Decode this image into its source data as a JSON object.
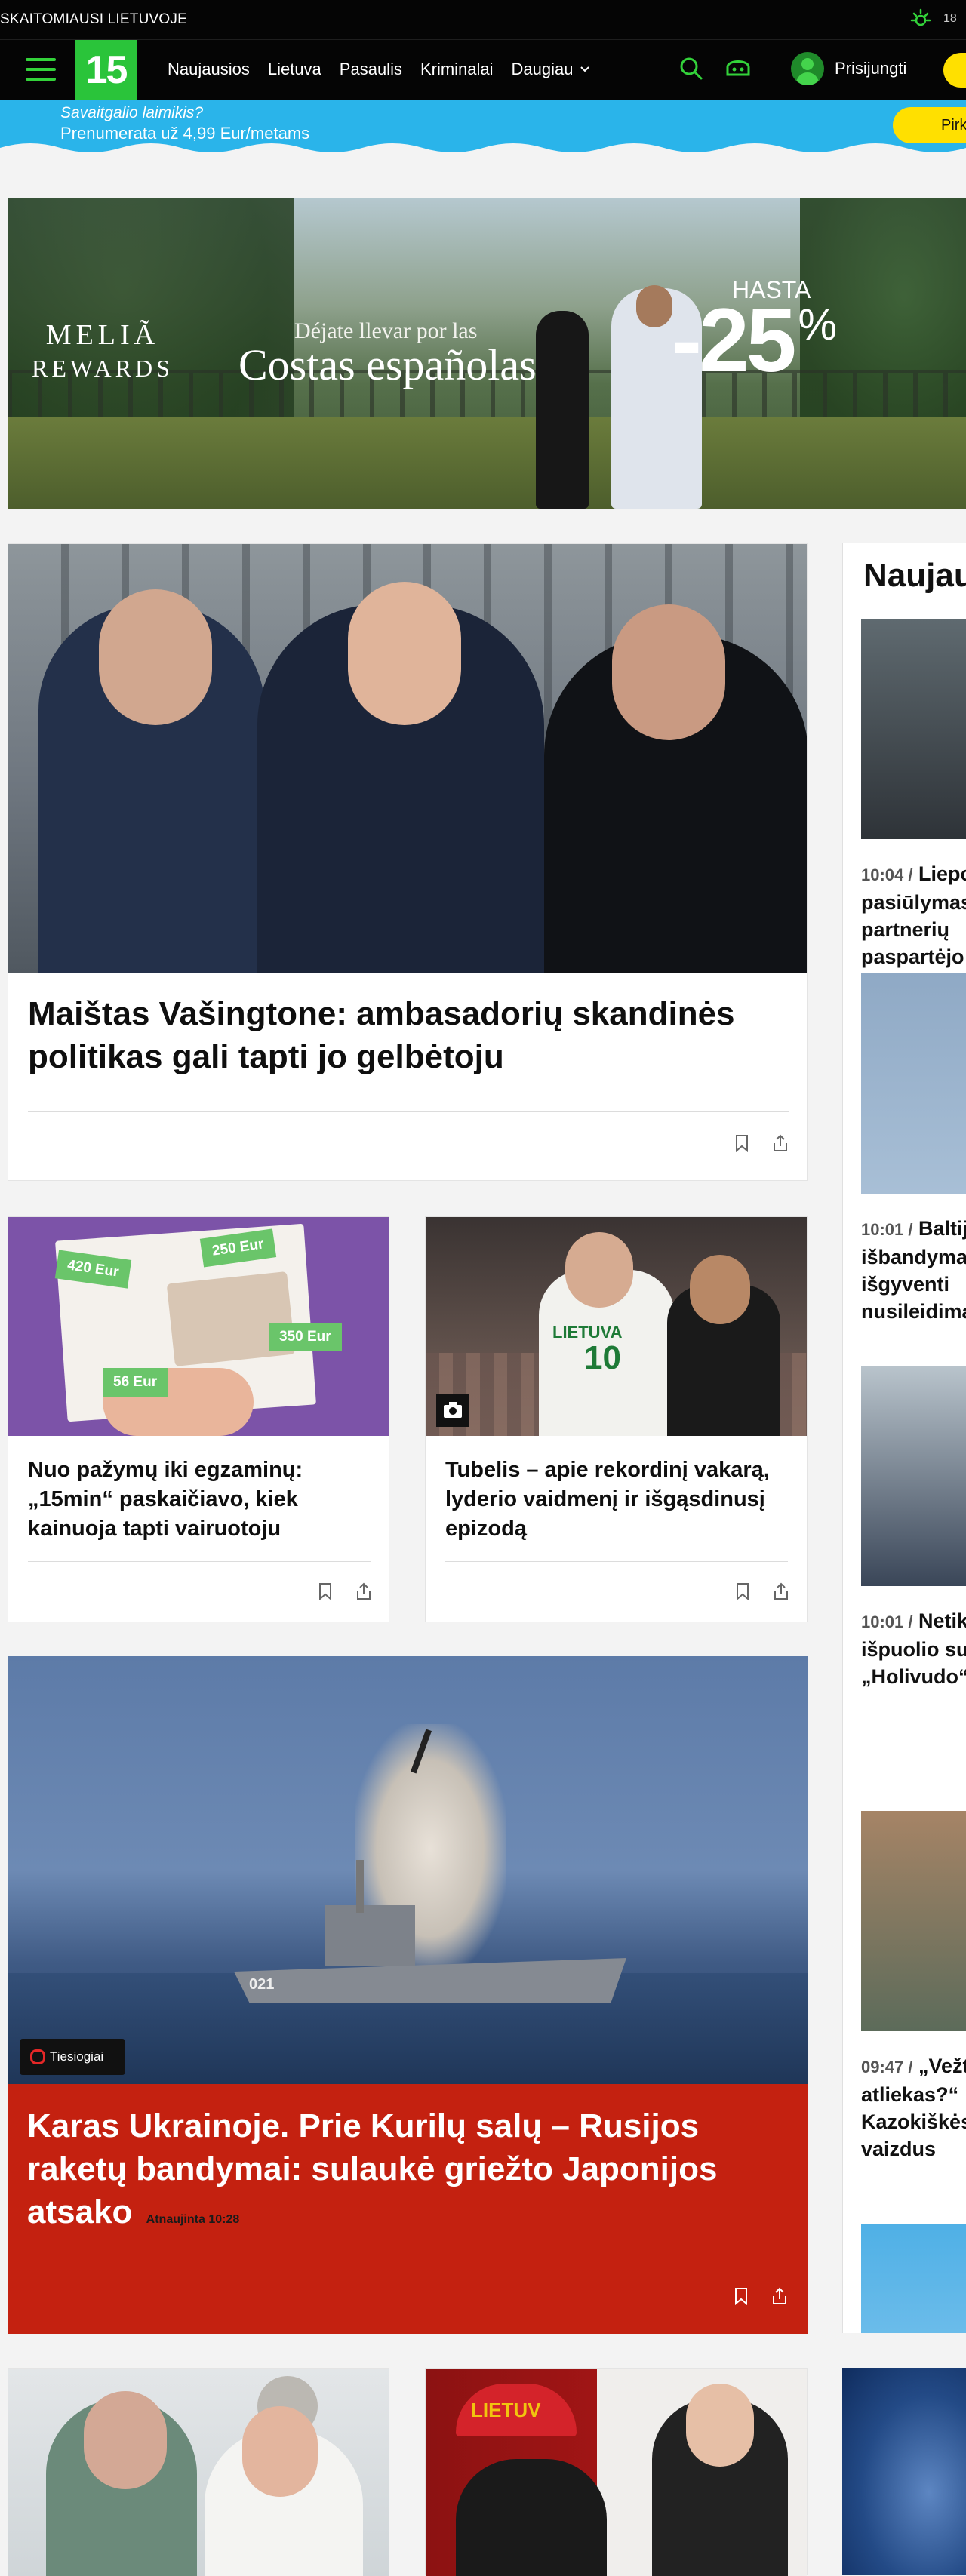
{
  "top": {
    "tagline": "SKAITOMIAUSI LIETUVOJE",
    "weather_temp": "18"
  },
  "nav": {
    "logo": "15",
    "links": [
      "Naujausios",
      "Lietuva",
      "Pasaulis",
      "Kriminalai",
      "Daugiau"
    ],
    "login": "Prisijungti",
    "accent": "#33d23a"
  },
  "promo": {
    "line1": "Savaitgalio laimikis?",
    "line2": "Prenumerata už 4,99 Eur/metams",
    "button": "Pirk"
  },
  "ad": {
    "brand_line1": "MELIÃ",
    "brand_line2": "REWARDS",
    "tagline_small": "Déjate llevar por las",
    "tagline_big": "Costas españolas",
    "hasta": "HASTA",
    "discount": "-25",
    "percent": "%"
  },
  "lead": {
    "title": "Maištas Vašingtone: ambasadorių skandinės politikas gali tapti jo gelbėtoju"
  },
  "card_left": {
    "title": "Nuo pažymų iki egzaminų: „15min“ paskaičiavo, kiek kainuoja tapti vairuotoju",
    "tags": [
      "420 Eur",
      "250 Eur",
      "350 Eur",
      "56 Eur"
    ]
  },
  "card_right": {
    "title": "Tubelis – apie rekordinį vakarą, lyderio vaidmenį ir išgąsdinusį epizodą",
    "jersey": "LIETUVA",
    "number": "10"
  },
  "live_story": {
    "badge": "Tiesiogiai",
    "title": "Karas Ukrainoje. Prie Kurilų salų – Rusijos raketų bandymai: sulaukė griežto Japonijos atsako",
    "updated": "Atnaujinta 10:28",
    "ship_number": "021",
    "bg": "#c42110"
  },
  "sidebar": {
    "title": "Naujausios",
    "items": [
      {
        "time": "10:04 /",
        "text": "Liepos pasiūlymas partnerių paspartėjo"
      },
      {
        "time": "10:01 /",
        "text": "Baltijos karių išbandymas: kaip išgyventi nusileidimą"
      },
      {
        "time": "10:01 /",
        "text": "Netikėto išpuolio sulaikytas „Holivudo“ kūrėjų"
      },
      {
        "time": "09:47 /",
        "text": "„Vežti atliekas?“ Kazokiškės vaizdus"
      }
    ]
  },
  "bottom": {
    "cap_text": "LIETUV"
  }
}
